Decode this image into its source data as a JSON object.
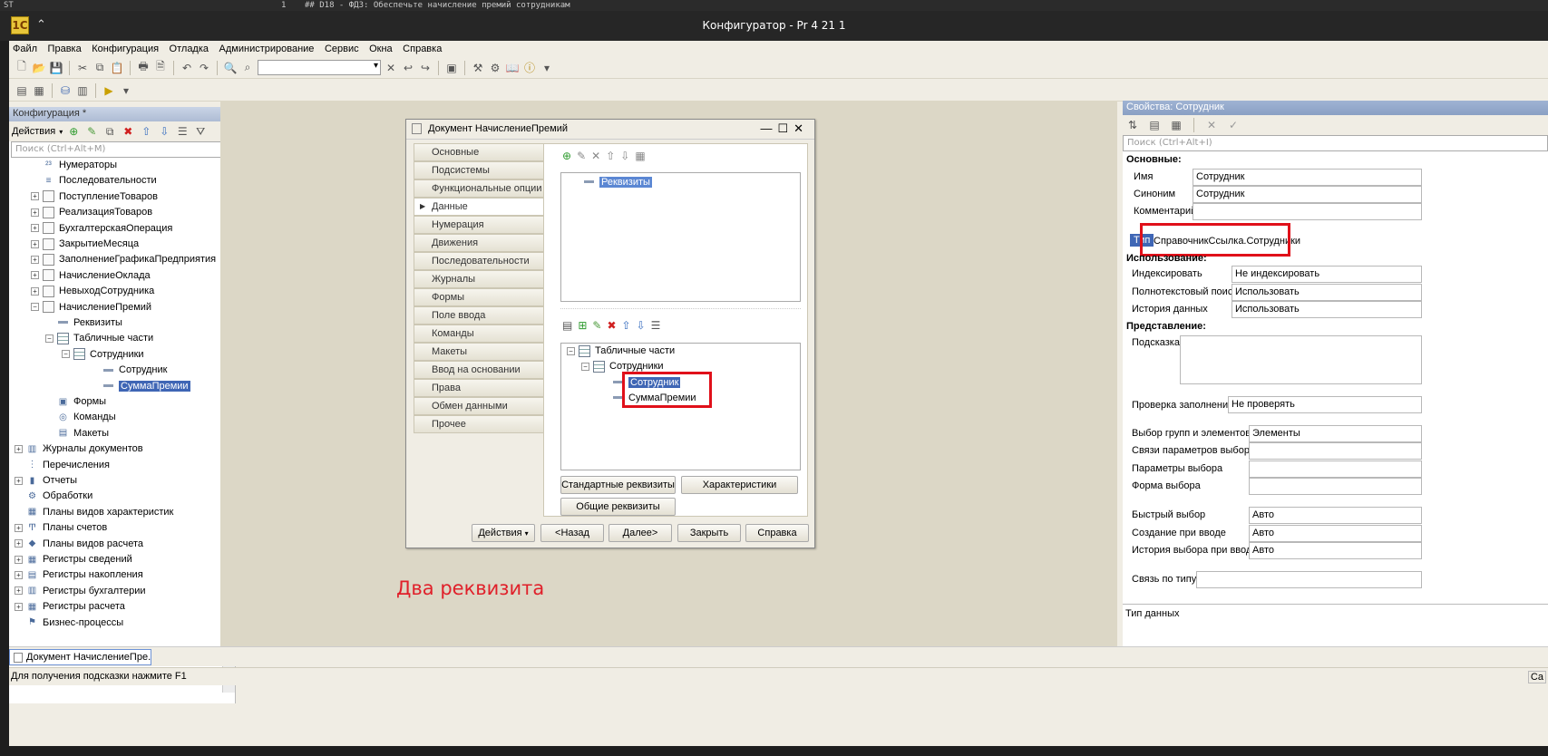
{
  "editor_strip": {
    "line_no": "1",
    "prefix": "ST",
    "text": "## D18 - ФДЗ: Обеспечьте начисление премий сотрудникам"
  },
  "window": {
    "title": "Конфигуратор - Pr 4 21 1"
  },
  "menu": [
    "Файл",
    "Правка",
    "Конфигурация",
    "Отладка",
    "Администрирование",
    "Сервис",
    "Окна",
    "Справка"
  ],
  "config_panel": {
    "title": "Конфигурация *",
    "actions_label": "Действия",
    "search_placeholder": "Поиск (Ctrl+Alt+M)",
    "tree": [
      {
        "label": "Нумераторы",
        "level": 2,
        "icon": "numerator-icon",
        "toggle": ""
      },
      {
        "label": "Последовательности",
        "level": 2,
        "icon": "sequence-icon",
        "toggle": ""
      },
      {
        "label": "ПоступлениеТоваров",
        "level": 2,
        "icon": "document-icon",
        "toggle": "+"
      },
      {
        "label": "РеализацияТоваров",
        "level": 2,
        "icon": "document-icon",
        "toggle": "+"
      },
      {
        "label": "БухгалтерскаяОперация",
        "level": 2,
        "icon": "document-icon",
        "toggle": "+"
      },
      {
        "label": "ЗакрытиеМесяца",
        "level": 2,
        "icon": "document-icon",
        "toggle": "+"
      },
      {
        "label": "ЗаполнениеГрафикаПредприятия",
        "level": 2,
        "icon": "document-icon",
        "toggle": "+"
      },
      {
        "label": "НачислениеОклада",
        "level": 2,
        "icon": "document-icon",
        "toggle": "+"
      },
      {
        "label": "НевыходСотрудника",
        "level": 2,
        "icon": "document-icon",
        "toggle": "+"
      },
      {
        "label": "НачислениеПремий",
        "level": 2,
        "icon": "document-icon",
        "toggle": "−"
      },
      {
        "label": "Реквизиты",
        "level": 3,
        "icon": "attribute-icon",
        "toggle": ""
      },
      {
        "label": "Табличные части",
        "level": 3,
        "icon": "table-icon",
        "toggle": "−"
      },
      {
        "label": "Сотрудники",
        "level": 4,
        "icon": "table-icon",
        "toggle": "−"
      },
      {
        "label": "Сотрудник",
        "level": 5,
        "icon": "attribute-icon",
        "toggle": ""
      },
      {
        "label": "СуммаПремии",
        "level": 5,
        "icon": "attribute-icon",
        "toggle": "",
        "selected": true
      },
      {
        "label": "Формы",
        "level": 3,
        "icon": "form-icon",
        "toggle": ""
      },
      {
        "label": "Команды",
        "level": 3,
        "icon": "command-icon",
        "toggle": ""
      },
      {
        "label": "Макеты",
        "level": 3,
        "icon": "template-icon",
        "toggle": ""
      },
      {
        "label": "Журналы документов",
        "level": 1,
        "icon": "journal-icon",
        "toggle": "+"
      },
      {
        "label": "Перечисления",
        "level": 1,
        "icon": "enum-icon",
        "toggle": ""
      },
      {
        "label": "Отчеты",
        "level": 1,
        "icon": "report-icon",
        "toggle": "+"
      },
      {
        "label": "Обработки",
        "level": 1,
        "icon": "processing-icon",
        "toggle": ""
      },
      {
        "label": "Планы видов характеристик",
        "level": 1,
        "icon": "chart-types-icon",
        "toggle": ""
      },
      {
        "label": "Планы счетов",
        "level": 1,
        "icon": "chart-accounts-icon",
        "toggle": "+"
      },
      {
        "label": "Планы видов расчета",
        "level": 1,
        "icon": "calc-types-icon",
        "toggle": "+"
      },
      {
        "label": "Регистры сведений",
        "level": 1,
        "icon": "info-register-icon",
        "toggle": "+"
      },
      {
        "label": "Регистры накопления",
        "level": 1,
        "icon": "accum-register-icon",
        "toggle": "+"
      },
      {
        "label": "Регистры бухгалтерии",
        "level": 1,
        "icon": "acc-register-icon",
        "toggle": "+"
      },
      {
        "label": "Регистры расчета",
        "level": 1,
        "icon": "calc-register-icon",
        "toggle": "+"
      },
      {
        "label": "Бизнес-процессы",
        "level": 1,
        "icon": "business-process-icon",
        "toggle": ""
      }
    ]
  },
  "dialog": {
    "title": "Документ НачислениеПремий",
    "nav": [
      "Основные",
      "Подсистемы",
      "Функциональные опции",
      "Данные",
      "Нумерация",
      "Движения",
      "Последовательности",
      "Журналы",
      "Формы",
      "Поле ввода",
      "Команды",
      "Макеты",
      "Ввод на основании",
      "Права",
      "Обмен данными",
      "Прочее"
    ],
    "active_nav": "Данные",
    "attributes_root": "Реквизиты",
    "tabular_root": "Табличные части",
    "tabular_child": "Сотрудники",
    "tabular_items": [
      "Сотрудник",
      "СуммаПремии"
    ],
    "btn_standard": "Стандартные реквизиты",
    "btn_characteristics": "Характеристики",
    "btn_common": "Общие реквизиты",
    "footer": {
      "actions": "Действия",
      "back": "<Назад",
      "next": "Далее>",
      "close": "Закрыть",
      "help": "Справка"
    }
  },
  "annotation": "Два реквизита",
  "properties": {
    "title": "Свойства: Сотрудник",
    "search_placeholder": "Поиск (Ctrl+Alt+I)",
    "group_main": "Основные:",
    "name_label": "Имя",
    "name_value": "Сотрудник",
    "synonym_label": "Синоним",
    "synonym_value": "Сотрудник",
    "comment_label": "Комментарий",
    "comment_value": "",
    "type_label": "Тип",
    "type_value": "СправочникСсылка.Сотрудники",
    "group_usage": "Использование:",
    "index_label": "Индексировать",
    "index_value": "Не индексировать",
    "fulltext_label": "Полнотекстовый поиск",
    "fulltext_value": "Использовать",
    "history_label": "История данных",
    "history_value": "Использовать",
    "group_view": "Представление:",
    "hint_label": "Подсказка",
    "fillcheck_label": "Проверка заполнения",
    "fillcheck_value": "Не проверять",
    "groups_label": "Выбор групп и элементов",
    "groups_value": "Элементы",
    "links_label": "Связи параметров выбора",
    "params_label": "Параметры выбора",
    "form_label": "Форма выбора",
    "quick_label": "Быстрый выбор",
    "quick_value": "Авто",
    "create_label": "Создание при вводе",
    "create_value": "Авто",
    "histsel_label": "История выбора при вводе",
    "histsel_value": "Авто",
    "typelink_label": "Связь по типу",
    "footer_label": "Тип данных"
  },
  "taskbar": {
    "task": "Документ НачислениеПре..."
  },
  "status": {
    "hint": "Для получения подсказки нажмите F1",
    "right": "Са"
  }
}
